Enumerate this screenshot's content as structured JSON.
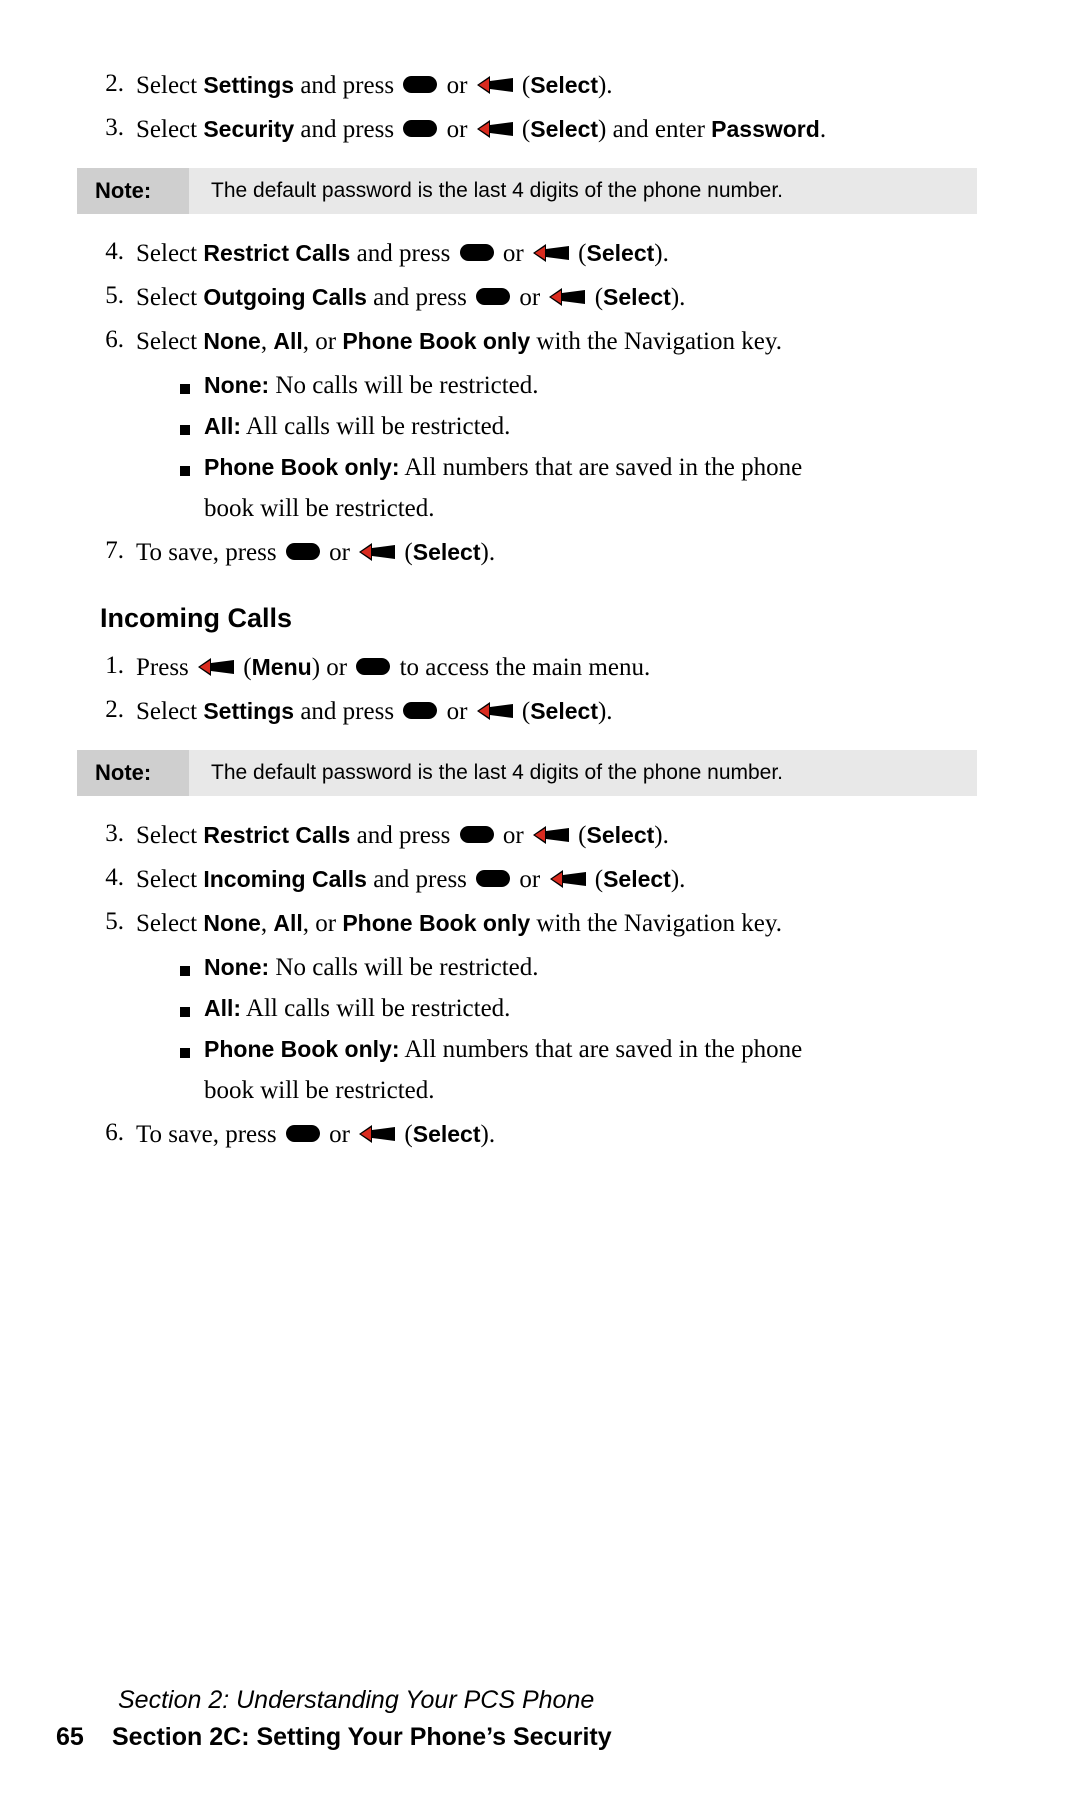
{
  "page": {
    "number": "65",
    "footer_section": "Section 2: Understanding Your PCS Phone",
    "footer_title": "Section 2C: Setting Your Phone’s Security"
  },
  "icons": {
    "ok_key": "ok-key-icon",
    "arrow_key": "left-arrow-softkey-icon"
  },
  "note": {
    "label": "Note:",
    "text": "The default password is the last 4 digits of the phone number."
  },
  "outgoing": {
    "steps": [
      {
        "num": "2.",
        "parts": [
          "Select ",
          "Settings",
          " and press ",
          "OK",
          " or ",
          "ARROW",
          " (",
          "Select",
          ")."
        ]
      },
      {
        "num": "3.",
        "parts": [
          "Select ",
          "Security",
          " and press ",
          "OK",
          " or ",
          "ARROW",
          " (",
          "Select",
          ") and enter ",
          "Password",
          "."
        ]
      },
      {
        "num": "4.",
        "parts": [
          "Select ",
          "Restrict Calls",
          " and press ",
          "OK",
          " or ",
          "ARROW",
          " (",
          "Select",
          ")."
        ]
      },
      {
        "num": "5.",
        "parts": [
          "Select ",
          "Outgoing Calls",
          " and press ",
          "OK",
          " or ",
          "ARROW",
          " (",
          "Select",
          ")."
        ]
      },
      {
        "num": "6.",
        "parts": [
          "Select ",
          "None",
          ", ",
          "All",
          ", or ",
          "Phone Book only",
          " with the Navigation key."
        ]
      },
      {
        "num": "7.",
        "parts": [
          "To save, press ",
          "OK",
          " or ",
          "ARROW",
          " (",
          "Select",
          ")."
        ]
      }
    ],
    "bullets": [
      {
        "term": "None:",
        "text": " No calls will be restricted."
      },
      {
        "term": "All:",
        "text": " All calls will be restricted."
      },
      {
        "term": "Phone Book only:",
        "text": " All numbers that are saved in the phone"
      }
    ],
    "bullet3_cont": "book will be restricted."
  },
  "incoming": {
    "heading": "Incoming Calls",
    "steps": [
      {
        "num": "1.",
        "parts": [
          "Press ",
          "ARROW",
          " (",
          "Menu",
          ") or ",
          "OK",
          " to access the main menu."
        ]
      },
      {
        "num": "2.",
        "parts": [
          "Select ",
          "Settings",
          " and press ",
          "OK",
          " or ",
          "ARROW",
          " (",
          "Select",
          ")."
        ]
      },
      {
        "num": "3.",
        "parts": [
          "Select ",
          "Restrict Calls",
          " and press ",
          "OK",
          " or ",
          "ARROW",
          " (",
          "Select",
          ")."
        ]
      },
      {
        "num": "4.",
        "parts": [
          "Select ",
          "Incoming Calls",
          " and press ",
          "OK",
          " or ",
          "ARROW",
          " (",
          "Select",
          ")."
        ]
      },
      {
        "num": "5.",
        "parts": [
          "Select ",
          "None",
          ", ",
          "All",
          ", or ",
          "Phone Book only",
          " with the Navigation key."
        ]
      },
      {
        "num": "6.",
        "parts": [
          "To save, press ",
          "OK",
          " or ",
          "ARROW",
          " (",
          "Select",
          ")."
        ]
      }
    ],
    "bullets": [
      {
        "term": "None:",
        "text": " No calls will be restricted."
      },
      {
        "term": "All:",
        "text": " All calls will be restricted."
      },
      {
        "term": "Phone Book only:",
        "text": " All numbers that are saved in the phone"
      }
    ],
    "bullet3_cont": "book will be restricted."
  },
  "colors": {
    "note_label_bg": "#cfcfcf",
    "note_bg": "#e8e8e8",
    "text": "#000000"
  }
}
